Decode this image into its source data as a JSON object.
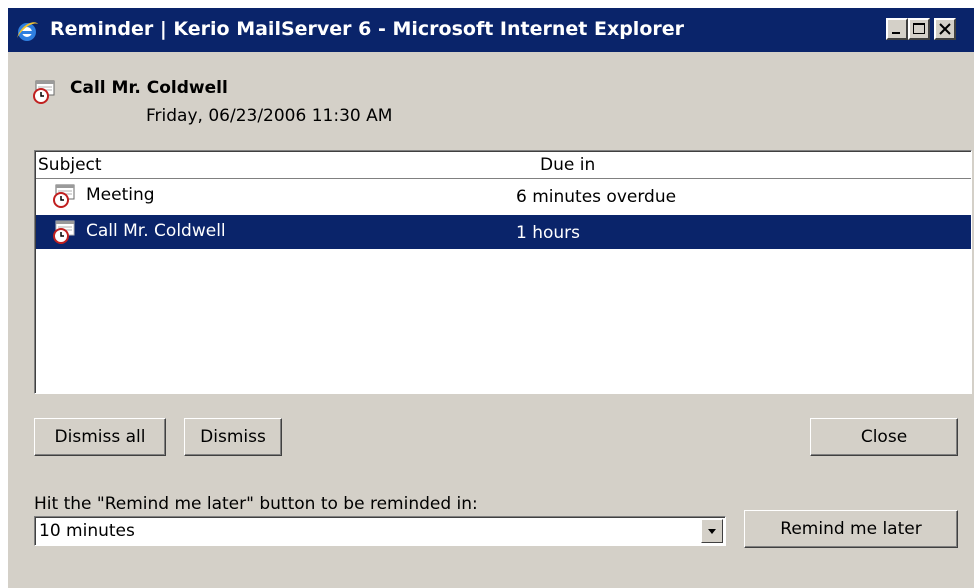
{
  "window": {
    "title": "Reminder | Kerio MailServer 6 - Microsoft Internet Explorer",
    "controls": [
      "minimize-icon",
      "maximize-icon",
      "close-icon"
    ]
  },
  "reminder": {
    "title": "Call Mr. Coldwell",
    "datetime": "Friday, 06/23/2006 11:30 AM",
    "icon": "calendar-clock-icon"
  },
  "list": {
    "columns": {
      "subject": "Subject",
      "due": "Due in"
    },
    "rows": [
      {
        "subject": "Meeting",
        "due": "6 minutes overdue",
        "icon": "calendar-clock-icon",
        "selected": false
      },
      {
        "subject": "Call Mr. Coldwell",
        "due": "1 hours",
        "icon": "calendar-clock-icon",
        "selected": true
      }
    ]
  },
  "buttons": {
    "dismiss_all": "Dismiss all",
    "dismiss": "Dismiss",
    "close": "Close",
    "remind_later": "Remind me later"
  },
  "snooze": {
    "hint": "Hit the \"Remind me later\" button to be reminded in:",
    "selected": "10 minutes"
  },
  "colors": {
    "titlebar": "#0a246a",
    "selection": "#0a246a",
    "face": "#d4d0c8"
  }
}
